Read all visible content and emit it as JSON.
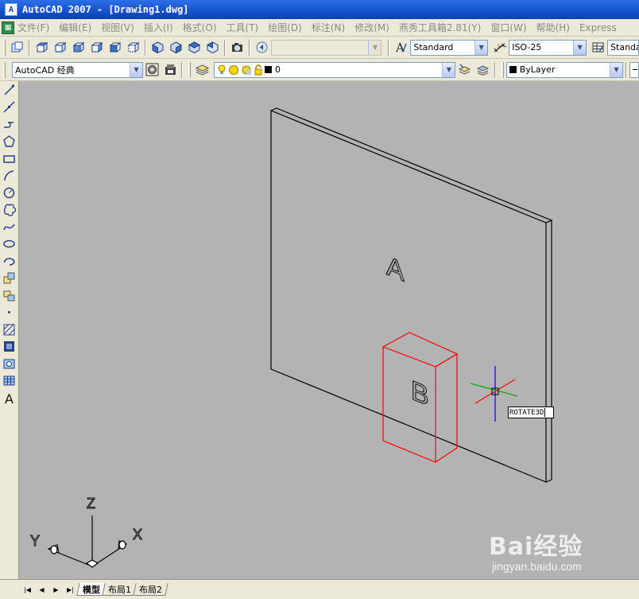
{
  "window": {
    "title": "AutoCAD 2007 - [Drawing1.dwg]"
  },
  "menu": {
    "items": [
      "文件(F)",
      "编辑(E)",
      "视图(V)",
      "插入(I)",
      "格式(O)",
      "工具(T)",
      "绘图(D)",
      "标注(N)",
      "修改(M)",
      "燕秀工具箱2.81(Y)",
      "窗口(W)",
      "帮助(H)",
      "Express"
    ]
  },
  "toolbar": {
    "text_style": "Standard",
    "dim_style": "ISO-25",
    "table_style": "Standard",
    "workspace": "AutoCAD 经典",
    "layer": "0",
    "color": "ByLayer"
  },
  "drawing": {
    "label_a": "A",
    "label_b": "B",
    "command_tooltip": "ROTATE3D",
    "ucs": {
      "z": "Z",
      "y": "Y",
      "x": "X"
    },
    "colors": {
      "background": "#b3b3b3",
      "edge": "#000000",
      "selected": "#ff0000"
    }
  },
  "tabs": {
    "items": [
      "模型",
      "布局1",
      "布局2"
    ],
    "active": "模型"
  },
  "watermark": {
    "logo": "Bai经验",
    "url": "jingyan.baidu.com"
  }
}
